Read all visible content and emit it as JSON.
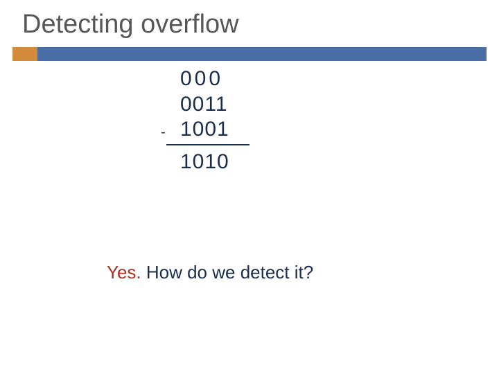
{
  "slide": {
    "title": "Detecting overflow"
  },
  "calc": {
    "carry": "000",
    "operand1": "0011",
    "operand2": "1001",
    "operator": "-",
    "result": "1010"
  },
  "footer": {
    "yes": "Yes.",
    "question": "  How do we detect it?"
  }
}
